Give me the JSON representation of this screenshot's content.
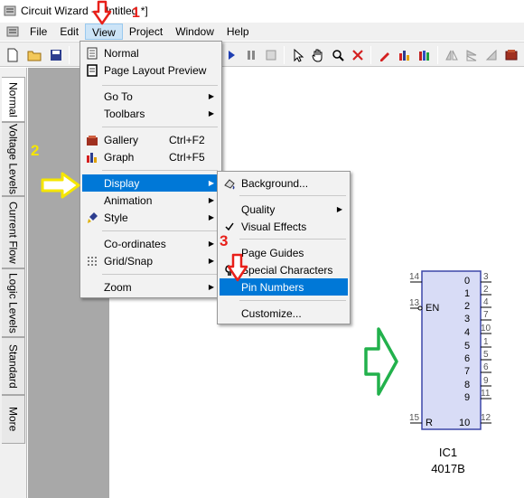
{
  "window": {
    "title": "Circuit Wizard - [Untitled *]"
  },
  "menubar": {
    "items": [
      "File",
      "Edit",
      "View",
      "Project",
      "Window",
      "Help"
    ]
  },
  "view_menu": {
    "items": [
      {
        "label": "Normal",
        "icon": "page-icon"
      },
      {
        "label": "Page Layout Preview",
        "icon": "page-layout-icon"
      },
      {
        "label": "Go To",
        "submenu": true
      },
      {
        "label": "Toolbars",
        "submenu": true
      },
      {
        "label": "Gallery",
        "shortcut": "Ctrl+F2",
        "icon": "gallery-icon"
      },
      {
        "label": "Graph",
        "shortcut": "Ctrl+F5",
        "icon": "graph-icon"
      },
      {
        "label": "Display",
        "submenu": true,
        "highlighted": true
      },
      {
        "label": "Animation",
        "submenu": true
      },
      {
        "label": "Style",
        "submenu": true,
        "icon": "style-brush-icon"
      },
      {
        "label": "Co-ordinates",
        "submenu": true
      },
      {
        "label": "Grid/Snap",
        "submenu": true,
        "icon": "grid-icon"
      },
      {
        "label": "Zoom",
        "submenu": true
      }
    ]
  },
  "display_menu": {
    "items": [
      {
        "label": "Background...",
        "icon": "background-icon"
      },
      {
        "label": "Quality",
        "submenu": true
      },
      {
        "label": "Visual Effects",
        "checked": true
      },
      {
        "label": "Page Guides"
      },
      {
        "label": "Special Characters",
        "icon": "special-chars-icon"
      },
      {
        "label": "Pin Numbers",
        "highlighted": true
      },
      {
        "label": "Customize..."
      }
    ]
  },
  "side_tabs": [
    "Normal",
    "Voltage Levels",
    "Current Flow",
    "Logic Levels",
    "Standard",
    "More"
  ],
  "annotations": {
    "step1": "1",
    "step2": "2",
    "step3": "3"
  },
  "component": {
    "name": "IC1",
    "part": "4017B",
    "left_pins": [
      {
        "number": "14",
        "label": ""
      },
      {
        "number": "13",
        "label": "EN"
      },
      {
        "number": "15",
        "label": "R"
      }
    ],
    "right_outputs": [
      {
        "label": "0",
        "number": "3"
      },
      {
        "label": "1",
        "number": "2"
      },
      {
        "label": "2",
        "number": "4"
      },
      {
        "label": "3",
        "number": "7"
      },
      {
        "label": "4",
        "number": "10"
      },
      {
        "label": "5",
        "number": "1"
      },
      {
        "label": "6",
        "number": "5"
      },
      {
        "label": "7",
        "number": "6"
      },
      {
        "label": "8",
        "number": "9"
      },
      {
        "label": "9",
        "number": "11"
      },
      {
        "label": "10",
        "number": "12"
      }
    ]
  },
  "colors": {
    "menu_highlight": "#0078d7",
    "annotation_red": "#e8201a",
    "annotation_yellow": "#f5e600",
    "annotation_green": "#22b14c",
    "chip_fill": "#d8dcf6",
    "chip_border": "#3c46a8"
  }
}
